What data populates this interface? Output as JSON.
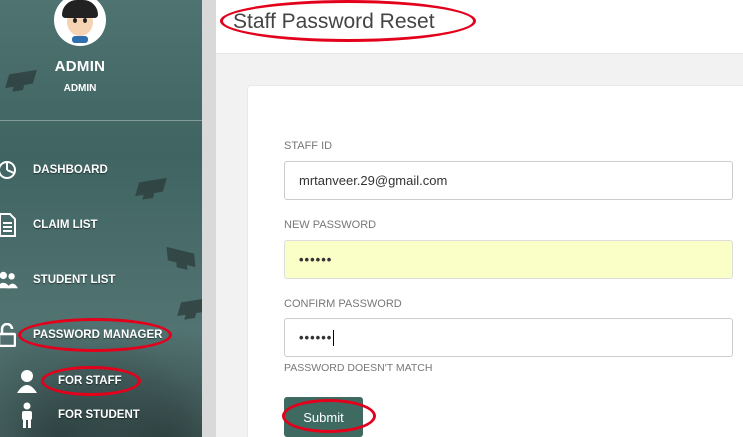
{
  "user": {
    "name": "ADMIN",
    "role": "ADMIN"
  },
  "sidebar": {
    "items": [
      {
        "label": "DASHBOARD",
        "icon": "dashboard-pie-icon"
      },
      {
        "label": "CLAIM LIST",
        "icon": "document-list-icon"
      },
      {
        "label": "STUDENT LIST",
        "icon": "users-icon"
      },
      {
        "label": "PASSWORD MANAGER",
        "icon": "unlock-icon"
      }
    ],
    "sub_items": [
      {
        "label": "FOR STAFF",
        "icon": "user-icon"
      },
      {
        "label": "FOR STUDENT",
        "icon": "student-icon"
      }
    ]
  },
  "header": {
    "title": "Staff Password Reset"
  },
  "form": {
    "staff_id_label": "STAFF ID",
    "staff_id_value": "mrtanveer.29@gmail.com",
    "new_password_label": "NEW PASSWORD",
    "new_password_mask": "••••••",
    "confirm_password_label": "CONFIRM PASSWORD",
    "confirm_password_mask": "••••••",
    "error_text": "PASSWORD DOESN'T MATCH",
    "submit_label": "Submit"
  },
  "colors": {
    "annotation": "#e3001b",
    "sidebar": "#4a6d6b",
    "submit": "#3f6a62",
    "autofill": "#fafec7"
  }
}
